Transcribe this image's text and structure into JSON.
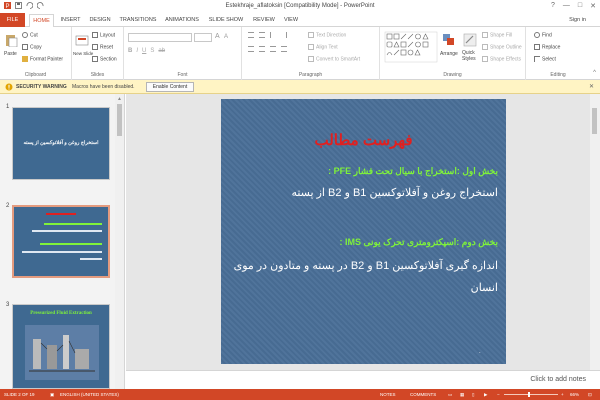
{
  "app": {
    "title": "Estekhraje_aflatoksin [Compatibility Mode] - PowerPoint"
  },
  "window": {
    "minimize": "—",
    "maximize": "□",
    "close": "✕",
    "help": "?",
    "signin": "Sign in"
  },
  "tabs": [
    {
      "label": "FILE"
    },
    {
      "label": "HOME"
    },
    {
      "label": "INSERT"
    },
    {
      "label": "DESIGN"
    },
    {
      "label": "TRANSITIONS"
    },
    {
      "label": "ANIMATIONS"
    },
    {
      "label": "SLIDE SHOW"
    },
    {
      "label": "REVIEW"
    },
    {
      "label": "VIEW"
    }
  ],
  "ribbon": {
    "clipboard": {
      "label": "Clipboard",
      "paste": "Paste",
      "cut": "Cut",
      "copy": "Copy",
      "format_painter": "Format Painter"
    },
    "slides": {
      "label": "Slides",
      "new_slide": "New Slide",
      "layout": "Layout",
      "reset": "Reset",
      "section": "Section"
    },
    "font": {
      "label": "Font"
    },
    "paragraph": {
      "label": "Paragraph",
      "text_direction": "Text Direction",
      "align_text": "Align Text",
      "convert_smartart": "Convert to SmartArt"
    },
    "drawing": {
      "label": "Drawing",
      "arrange": "Arrange",
      "quick_styles": "Quick Styles",
      "shape_fill": "Shape Fill",
      "shape_outline": "Shape Outline",
      "shape_effects": "Shape Effects"
    },
    "editing": {
      "label": "Editing",
      "find": "Find",
      "replace": "Replace",
      "select": "Select"
    }
  },
  "security": {
    "label": "SECURITY WARNING",
    "message": "Macros have been disabled.",
    "button": "Enable Content",
    "close": "✕"
  },
  "thumbnails": [
    {
      "num": "1",
      "title": "استخراج روغن و آفلاتوکسین از پسته"
    },
    {
      "num": "2"
    },
    {
      "num": "3",
      "title": "Pressurized Fluid Extraction"
    }
  ],
  "slide": {
    "title": "فهرست مطالب",
    "part1_heading": "بخش اول :استخراج با سیال تحت فشار PFE :",
    "part1_body": "استخراج روغن و آفلاتوکسین B1 و B2 از پسته",
    "part2_heading": "بخش دوم :اسپکترومتری تحرک یونی IMS :",
    "part2_body_1": "اندازه گیری آفلاتوکسین B1 و B2  در پسته و متادون در موی",
    "part2_body_2": "انسان",
    "dot": "."
  },
  "notes": {
    "placeholder": "Click to add notes"
  },
  "status": {
    "slide": "SLIDE 2 OF 19",
    "language": "ENGLISH (UNITED STATES)",
    "notes": "NOTES",
    "comments": "COMMENTS",
    "zoom": "66%",
    "zoom_minus": "−",
    "zoom_plus": "+"
  },
  "colors": {
    "accent": "#d24726",
    "slide_bg": "#4a6f98",
    "slide_title": "#e02020",
    "slide_heading": "#7ff23a",
    "warning_bar": "#fff4c4"
  }
}
